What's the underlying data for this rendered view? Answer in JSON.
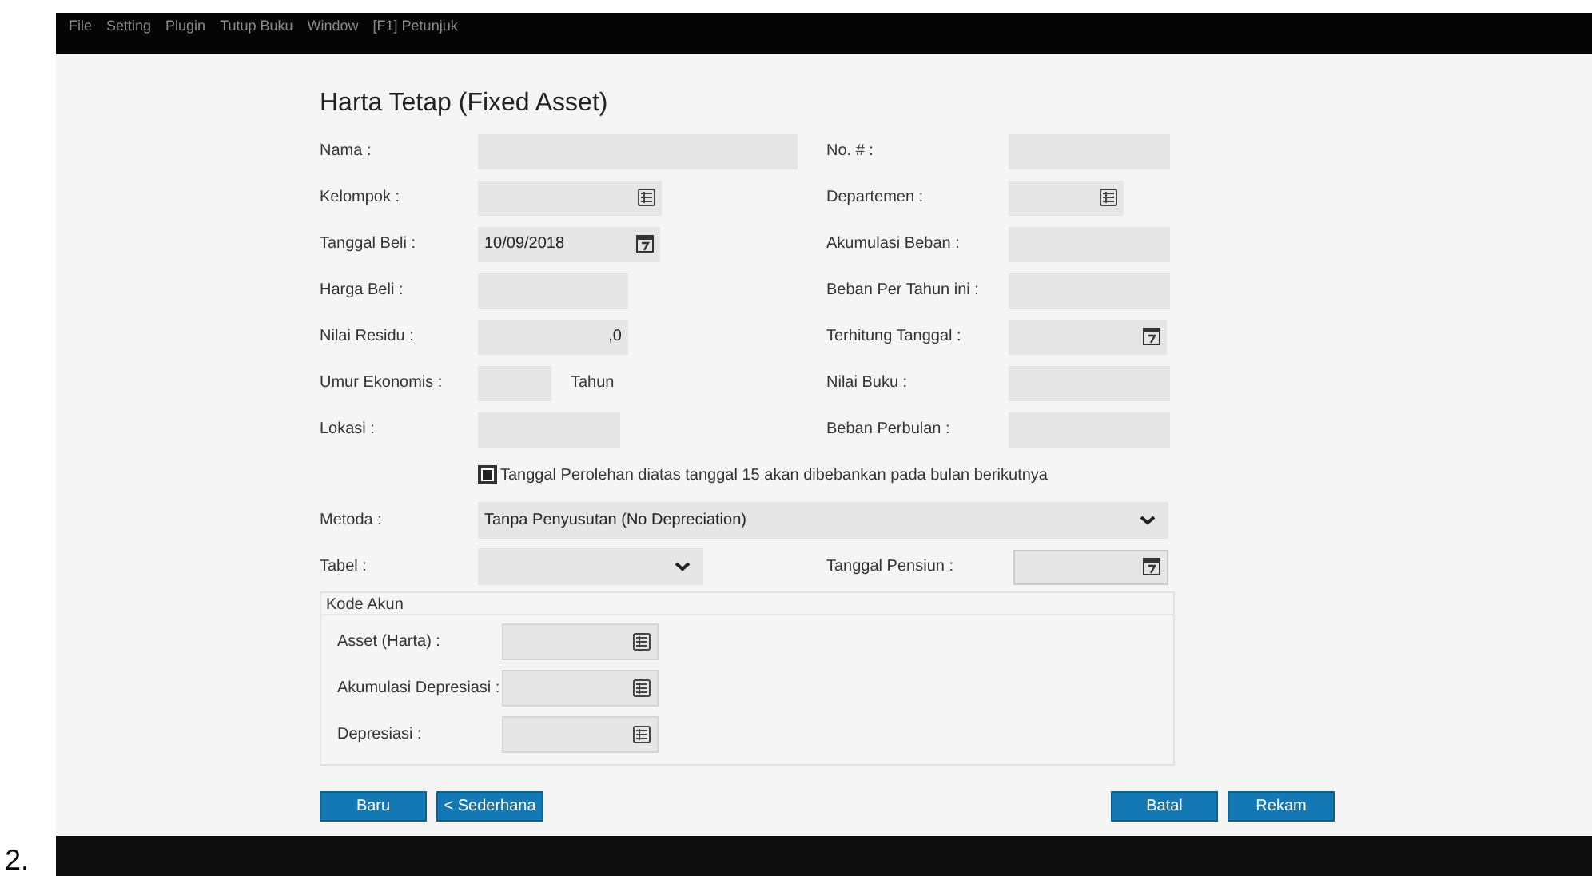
{
  "menu": [
    "File",
    "Setting",
    "Plugin",
    "Tutup Buku",
    "Window",
    "[F1] Petunjuk"
  ],
  "title": "Harta Tetap (Fixed Asset)",
  "rows": [
    {
      "left": {
        "label": "Nama :",
        "kind": "wide"
      },
      "right": {
        "label": "No. # :",
        "kind": "text"
      }
    },
    {
      "left": {
        "label": "Kelompok :",
        "kind": "lookup"
      },
      "right": {
        "label": "Departemen :",
        "kind": "lookup-short"
      }
    },
    {
      "left": {
        "label": "Tanggal Beli :",
        "kind": "date",
        "value": "10/09/2018"
      },
      "right": {
        "label": "Akumulasi Beban :",
        "kind": "text"
      }
    },
    {
      "left": {
        "label": "Harga Beli :",
        "kind": "amount"
      },
      "right": {
        "label": "Beban Per Tahun ini :",
        "kind": "text"
      }
    },
    {
      "left": {
        "label": "Nilai Residu :",
        "kind": "amount",
        "value": ",0"
      },
      "right": {
        "label": "Terhitung Tanggal :",
        "kind": "date-short"
      }
    },
    {
      "left": {
        "label": "Umur Ekonomis :",
        "kind": "unit",
        "unit": "Tahun"
      },
      "right": {
        "label": "Nilai Buku :",
        "kind": "text"
      }
    },
    {
      "left": {
        "label": "Lokasi :",
        "kind": "medium"
      },
      "right": {
        "label": "Beban Perbulan :",
        "kind": "text"
      }
    }
  ],
  "checkbox": {
    "label": "Tanggal Perolehan diatas tanggal 15 akan dibebankan pada bulan berikutnya",
    "checked": true
  },
  "metoda": {
    "label": "Metoda :",
    "value": "Tanpa Penyusutan (No Depreciation)"
  },
  "tabel": {
    "label": "Tabel :"
  },
  "pensiun": {
    "label": "Tanggal Pensiun :"
  },
  "kode_akun": {
    "title": "Kode Akun",
    "fields": [
      {
        "label": "Asset (Harta) :"
      },
      {
        "label": "Akumulasi Depresiasi :"
      },
      {
        "label": "Depresiasi :"
      }
    ]
  },
  "buttons_left": [
    "Baru",
    "< Sederhana"
  ],
  "buttons_right": [
    "Batal",
    "Rekam"
  ],
  "page_label": "2."
}
